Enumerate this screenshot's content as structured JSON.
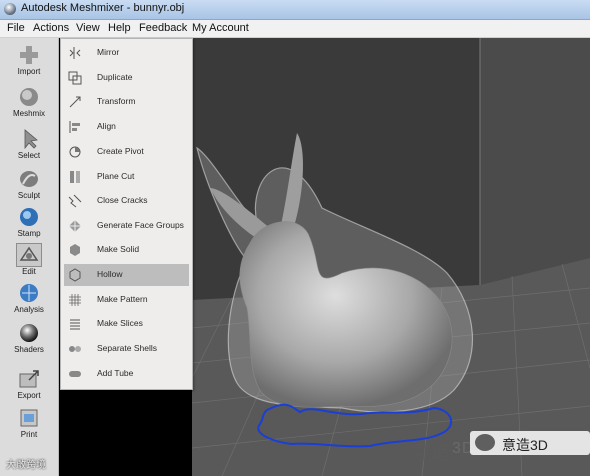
{
  "window": {
    "title": "Autodesk Meshmixer - bunnyr.obj"
  },
  "menubar": {
    "items": [
      {
        "key": "file",
        "label": "File"
      },
      {
        "key": "actions",
        "label": "Actions"
      },
      {
        "key": "view",
        "label": "View"
      },
      {
        "key": "help",
        "label": "Help"
      },
      {
        "key": "feedback",
        "label": "Feedback"
      },
      {
        "key": "account",
        "label": "My Account"
      }
    ]
  },
  "toolbar": {
    "items": [
      {
        "key": "import",
        "label": "Import",
        "icon": "plus-icon"
      },
      {
        "key": "meshmix",
        "label": "Meshmix",
        "icon": "meshmix-icon"
      },
      {
        "key": "select",
        "label": "Select",
        "icon": "cursor-arrow-icon"
      },
      {
        "key": "sculpt",
        "label": "Sculpt",
        "icon": "sculpt-brush-icon"
      },
      {
        "key": "stamp",
        "label": "Stamp",
        "icon": "stamp-icon"
      },
      {
        "key": "edit",
        "label": "Edit",
        "icon": "edit-icon",
        "active": true
      },
      {
        "key": "analysis",
        "label": "Analysis",
        "icon": "analysis-icon"
      },
      {
        "key": "shaders",
        "label": "Shaders",
        "icon": "shader-sphere-icon"
      },
      {
        "key": "export",
        "label": "Export",
        "icon": "export-icon"
      },
      {
        "key": "print",
        "label": "Print",
        "icon": "print-icon"
      }
    ]
  },
  "edit_menu": {
    "items": [
      {
        "key": "mirror",
        "label": "Mirror",
        "icon": "mirror-icon"
      },
      {
        "key": "duplicate",
        "label": "Duplicate",
        "icon": "duplicate-icon"
      },
      {
        "key": "transform",
        "label": "Transform",
        "icon": "transform-icon"
      },
      {
        "key": "align",
        "label": "Align",
        "icon": "align-icon"
      },
      {
        "key": "create-pivot",
        "label": "Create Pivot",
        "icon": "pivot-icon"
      },
      {
        "key": "plane-cut",
        "label": "Plane Cut",
        "icon": "plane-cut-icon"
      },
      {
        "key": "close-cracks",
        "label": "Close Cracks",
        "icon": "close-cracks-icon"
      },
      {
        "key": "face-groups",
        "label": "Generate Face Groups",
        "icon": "face-groups-icon"
      },
      {
        "key": "make-solid",
        "label": "Make Solid",
        "icon": "make-solid-icon"
      },
      {
        "key": "hollow",
        "label": "Hollow",
        "icon": "hollow-icon",
        "selected": true
      },
      {
        "key": "make-pattern",
        "label": "Make Pattern",
        "icon": "pattern-icon"
      },
      {
        "key": "make-slices",
        "label": "Make Slices",
        "icon": "slices-icon"
      },
      {
        "key": "separate-shells",
        "label": "Separate Shells",
        "icon": "separate-shells-icon"
      },
      {
        "key": "add-tube",
        "label": "Add Tube",
        "icon": "tube-icon"
      }
    ]
  },
  "watermarks": {
    "left": "大敢跨境",
    "right_cn": "意造",
    "right_en": "3D",
    "badge": "意造3D"
  },
  "colors": {
    "viewport_bg": "#3a3a3a",
    "grid_floor": "#595959",
    "grid_line": "#7a7a7a",
    "boundary_line": "#1a3fd6",
    "selected_item": "#bdbdbd"
  }
}
